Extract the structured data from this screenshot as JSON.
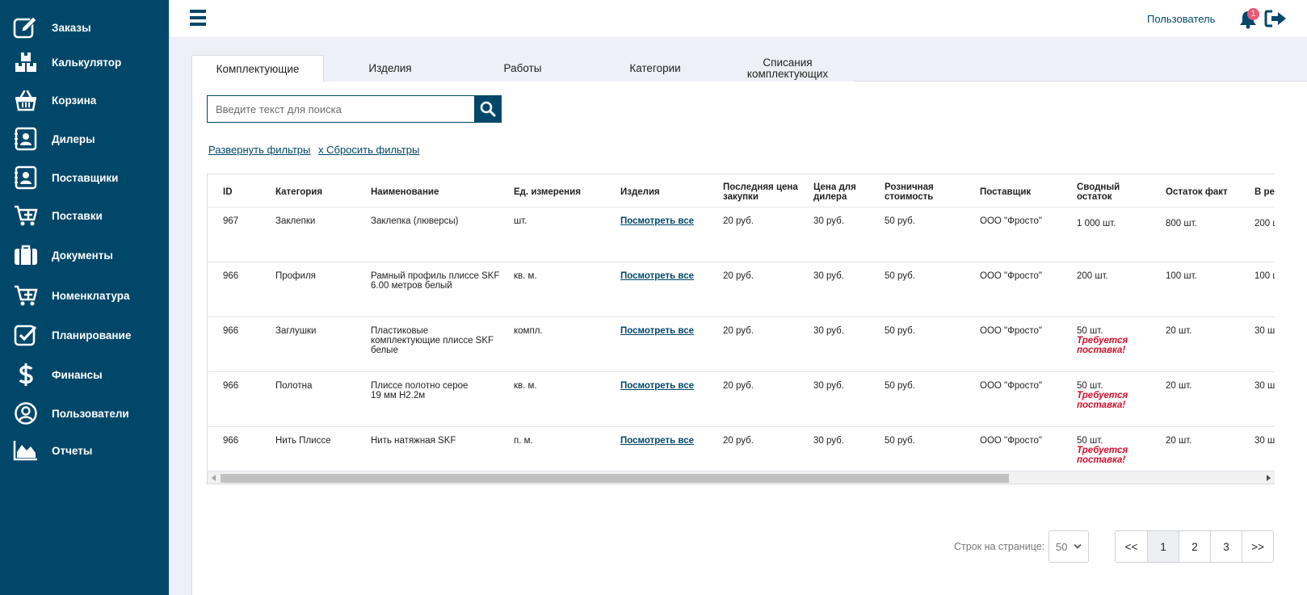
{
  "sidebar": {
    "items": [
      {
        "label": "Заказы",
        "icon": "edit-icon"
      },
      {
        "label": "Калькулятор",
        "icon": "boxes-icon"
      },
      {
        "label": "Корзина",
        "icon": "basket-icon"
      },
      {
        "label": "Дилеры",
        "icon": "contact-card-icon"
      },
      {
        "label": "Поставщики",
        "icon": "contact-card-icon"
      },
      {
        "label": "Поставки",
        "icon": "cart-plus-icon"
      },
      {
        "label": "Документы",
        "icon": "briefcase-icon"
      },
      {
        "label": "Номенклатура",
        "icon": "cart-plus-icon"
      },
      {
        "label": "Планирование",
        "icon": "checkbox-icon"
      },
      {
        "label": "Финансы",
        "icon": "dollar-icon"
      },
      {
        "label": "Пользователи",
        "icon": "user-circle-icon"
      },
      {
        "label": "Отчеты",
        "icon": "area-chart-icon"
      }
    ]
  },
  "header": {
    "user_label": "Пользователь",
    "notifications_count": "1"
  },
  "tabs": [
    {
      "label": "Комплектующие",
      "active": true
    },
    {
      "label": "Изделия",
      "active": false
    },
    {
      "label": "Работы",
      "active": false
    },
    {
      "label": "Категории",
      "active": false
    },
    {
      "label": "Списания комплектующих",
      "active": false
    }
  ],
  "search": {
    "placeholder": "Введите текст для поиска"
  },
  "filters": {
    "expand_label": "Развернуть фильтры",
    "reset_label": "x Сбросить фильтры"
  },
  "table": {
    "columns": [
      "ID",
      "Категория",
      "Наименование",
      "Ед. измерения",
      "Изделия",
      "Последняя цена закупки",
      "Цена для дилера",
      "Розничная стоимость",
      "Поставщик",
      "Сводный остаток",
      "Остаток факт",
      "В ре"
    ],
    "rows": [
      {
        "id": "967",
        "category": "Заклепки",
        "name": "Заклепка (люверсы)",
        "unit": "шт.",
        "products": "Посмотреть все",
        "last_price": "20 руб.",
        "dealer_price": "30 руб.",
        "retail_price": "50 руб.",
        "supplier": "ООО \"Фросто\"",
        "total_stock": "1 000 шт.",
        "warning": "",
        "actual_stock": "800 шт.",
        "reserve": "200 ш"
      },
      {
        "id": "966",
        "category": "Профиля",
        "name": "Рамный профиль плиссе SKF 6.00 метров белый",
        "unit": "кв. м.",
        "products": "Посмотреть все",
        "last_price": "20 руб.",
        "dealer_price": "30 руб.",
        "retail_price": "50 руб.",
        "supplier": "ООО \"Фросто\"",
        "total_stock": "200 шт.",
        "warning": "",
        "actual_stock": "100 шт.",
        "reserve": "100 ш"
      },
      {
        "id": "966",
        "category": "Заглушки",
        "name": "Пластиковые комплектующие плиссе SKF белые",
        "unit": "компл.",
        "products": "Посмотреть все",
        "last_price": "20 руб.",
        "dealer_price": "30 руб.",
        "retail_price": "50 руб.",
        "supplier": "ООО \"Фросто\"",
        "total_stock": "50 шт.",
        "warning": "Требуется поставка!",
        "actual_stock": "20 шт.",
        "reserve": "30 ш"
      },
      {
        "id": "966",
        "category": "Полотна",
        "name": "Плиссе полотно серое 19 мм H2.2м",
        "unit": "кв. м.",
        "products": "Посмотреть все",
        "last_price": "20 руб.",
        "dealer_price": "30 руб.",
        "retail_price": "50 руб.",
        "supplier": "ООО \"Фросто\"",
        "total_stock": "50 шт.",
        "warning": "Требуется поставка!",
        "actual_stock": "20 шт.",
        "reserve": "30 ш"
      },
      {
        "id": "966",
        "category": "Нить Плиссе",
        "name": "Нить натяжная SKF",
        "unit": "п. м.",
        "products": "Посмотреть все",
        "last_price": "20 руб.",
        "dealer_price": "30 руб.",
        "retail_price": "50 руб.",
        "supplier": "ООО \"Фросто\"",
        "total_stock": "50 шт.",
        "warning": "Требуется поставка!",
        "actual_stock": "20 шт.",
        "reserve": "30 ш"
      }
    ]
  },
  "pagination": {
    "rows_per_page_label": "Строк на странице:",
    "rows_per_page_value": "50",
    "first_label": "<<",
    "pages": [
      "1",
      "2",
      "3"
    ],
    "current_page": "1",
    "last_label": ">>"
  },
  "colors": {
    "primary": "#004769",
    "background": "#eeeff7",
    "warning": "#d0102c",
    "badge": "#ea5a73"
  }
}
